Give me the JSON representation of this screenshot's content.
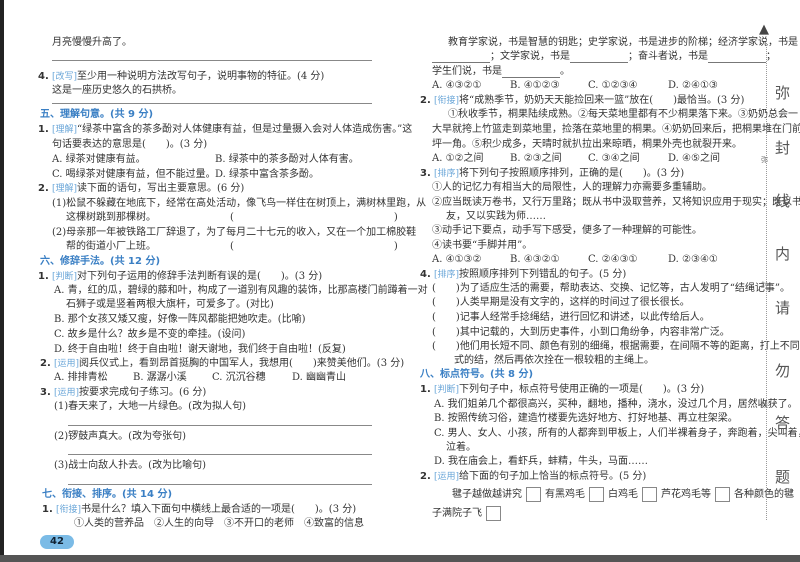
{
  "left": {
    "l1": "月亮慢慢升高了。",
    "q4": {
      "num": "4.",
      "tag": "[改写]",
      "text": "至少用一种说明方法改写句子，说明事物的特征。(4 分)",
      "sentence": "这是一座历史悠久的石拱桥。"
    },
    "s5": {
      "title": "五、理解句意。(共 9 分)",
      "q1": {
        "num": "1.",
        "tag": "[理解]",
        "text": "“绿茶中富含的茶多酚对人体健康有益，但是过量摄入会对人体造成伤害。”这",
        "text2": "句话要表达的意思是(　　)。(3 分)",
        "A": "A. 绿茶对健康有益。",
        "B": "B. 绿茶中的茶多酚对人体有害。",
        "C": "C. 喝绿茶对健康有益，但不能过量。",
        "D": "D. 绿茶中富含茶多酚。"
      },
      "q2": {
        "num": "2.",
        "tag": "[理解]",
        "text": "读下面的语句，写出主要意思。(6 分)",
        "s1a": "(1)松鼠不躲藏在地底下，经常在高处活动，像飞鸟一样住在树顶上，满树林里跑，从",
        "s1b": "这棵树跳到那棵树。",
        "s2a": "(2)母亲那一年被铁路工厂辞退了，为了每月二十七元的收入，又在一个加工棉胶鞋",
        "s2b": "帮的街道小厂上班。",
        "paren": "(　　　　　　　　　　　　　　　　)"
      }
    },
    "s6": {
      "title": "六、修辞手法。(共 12 分)",
      "q1": {
        "num": "1.",
        "tag": "[判断]",
        "text": "对下列句子运用的修辞手法判断有误的是(　　)。(3 分)",
        "A1": "A. 青，红的瓜，碧绿的藤和叶，构成了一道别有风趣的装饰，比那高楼门前蹲着一对",
        "A2": "石狮子或是竖着两根大旗杆，可爱多了。(对比)",
        "B": "B. 那个女孩又矮又瘦，好像一阵风都能把她吹走。(比喻)",
        "C": "C. 故乡是什么？故乡是不变的牵挂。(设问)",
        "D": "D. 终于自由啦！终于自由啦！谢天谢地，我们终于自由啦！(反复)"
      },
      "q2": {
        "num": "2.",
        "tag": "[运用]",
        "text": "阅兵仪式上，看到昂首挺胸的中国军人，我想用(　　)来赞美他们。(3 分)",
        "A": "A. 排排青松",
        "B": "B. 潺潺小溪",
        "C": "C. 沉沉谷穗",
        "D": "D. 幽幽青山"
      },
      "q3": {
        "num": "3.",
        "tag": "[运用]",
        "text": "按要求完成句子练习。(6 分)",
        "s1": "(1)春天来了，大地一片绿色。(改为拟人句)",
        "s2": "(2)锣鼓声真大。(改为夸张句)",
        "s3": "(3)战士向敌人扑去。(改为比喻句)"
      }
    },
    "s7": {
      "title": "七、衔接、排序。(共 14 分)",
      "q1": {
        "num": "1.",
        "tag": "[衔接]",
        "text": "书是什么？填入下面句中横线上最合适的一项是(　　)。(3 分)",
        "opts": "①人类的营养品　②人生的向导　③不开口的老师　④致富的信息"
      }
    },
    "page_number": "42"
  },
  "right": {
    "p1": "教育学家说，书是智慧的钥匙；史学家说，书是进步的阶梯；经济学家说，书是",
    "p2a": "；文学家说，书是",
    "p2b": "；奋斗者说，书是",
    "p2c": "；",
    "p3": "学生们说，书是",
    "p3end": "。",
    "q1opts": {
      "A": "A. ④③②①",
      "B": "B. ④①②③",
      "C": "C. ①②③④",
      "D": "D. ②④①③"
    },
    "q2": {
      "num": "2.",
      "tag": "[衔接]",
      "text": "将“成熟季节，奶奶天天能捡回来一篮”放在(　　)最恰当。(3 分)",
      "p1": "①秋收季节，桐果陆续成熟。②每天菜地里都有不少桐果落下来。③奶奶总会一",
      "p2": "大早就挎上竹篮走到菜地里，捡落在菜地里的桐果。④奶奶回来后，把桐果堆在门前空",
      "p3": "坪一角。⑤积少成多，天晴时就扒拉出来晾晒，桐果外壳也就裂开来。",
      "A": "A. ①②之间",
      "B": "B. ②③之间",
      "C": "C. ③④之间",
      "D": "D. ④⑤之间"
    },
    "q3": {
      "num": "3.",
      "tag": "[排序]",
      "text": "将下列句子按照顺序排列，正确的是(　　)。(3 分)",
      "s1": "①人的记忆力有相当大的局限性，人的理解力亦需要多重辅助。",
      "s2a": "②应当既读万卷书，又行万里路；既从书中汲取营养，又将知识应用于现实；既以书为",
      "s2b": "友，又以实践为师……",
      "s3": "③动手记下要点，动手写下感受，便多了一种理解的可能性。",
      "s4": "④读书要“手脚并用”。",
      "A": "A. ④①③②",
      "B": "B. ④③②①",
      "C": "C. ②④③①",
      "D": "D. ②③④①"
    },
    "q4": {
      "num": "4.",
      "tag": "[排序]",
      "text": "按照顺序排列下列错乱的句子。(5 分)",
      "paren": "(　　)",
      "r1": "为了适应生活的需要，帮助表达、交换、记忆等，古人发明了“结绳记事”。",
      "r2": "人类早期是没有文字的，这样的时间过了很长很长。",
      "r3": "记事人经常手捻绳结，进行回忆和讲述，以此传给后人。",
      "r4": "其中记载的，大到历史事件，小到口角纷争，内容非常广泛。",
      "r5a": "他们用长短不同、颜色有别的细绳，根据需要，在间隔不等的距离，打上不同形",
      "r5b": "式的结，然后再依次拴在一根较粗的主绳上。"
    },
    "s8": {
      "title": "八、标点符号。(共 8 分)",
      "q1": {
        "num": "1.",
        "tag": "[判断]",
        "text": "下列句子中，标点符号使用正确的一项是(　　)。(3 分)",
        "A": "A. 我们姐弟几个都很高兴，买种，翻地，播种，浇水，没过几个月，居然收获了。",
        "B": "B. 按照传统习俗，建造竹楼要先选好地方、打好地基、再立柱架梁。",
        "C1": "C. 男人、女人、小孩，所有的人都奔到甲板上，人们半裸着身子，奔跑着，尖叫着，哭",
        "C2": "泣着。",
        "D": "D. 我在庙会上，看虾兵，蚌精，牛头，马面……"
      },
      "q2": {
        "num": "2.",
        "tag": "[运用]",
        "text": "给下面的句子加上恰当的标点符号。(5 分)",
        "w1": "毽子越做越讲究",
        "w2": "有黑鸡毛",
        "w3": "白鸡毛",
        "w4": "芦花鸡毛等",
        "w5": "各种颜色的毽",
        "w6": "子满院子飞"
      }
    }
  },
  "sidebar": {
    "chars": [
      "弥",
      "封",
      "线",
      "内",
      "请",
      "勿",
      "答",
      "题"
    ],
    "small": [
      "弥",
      "封",
      "线"
    ]
  }
}
